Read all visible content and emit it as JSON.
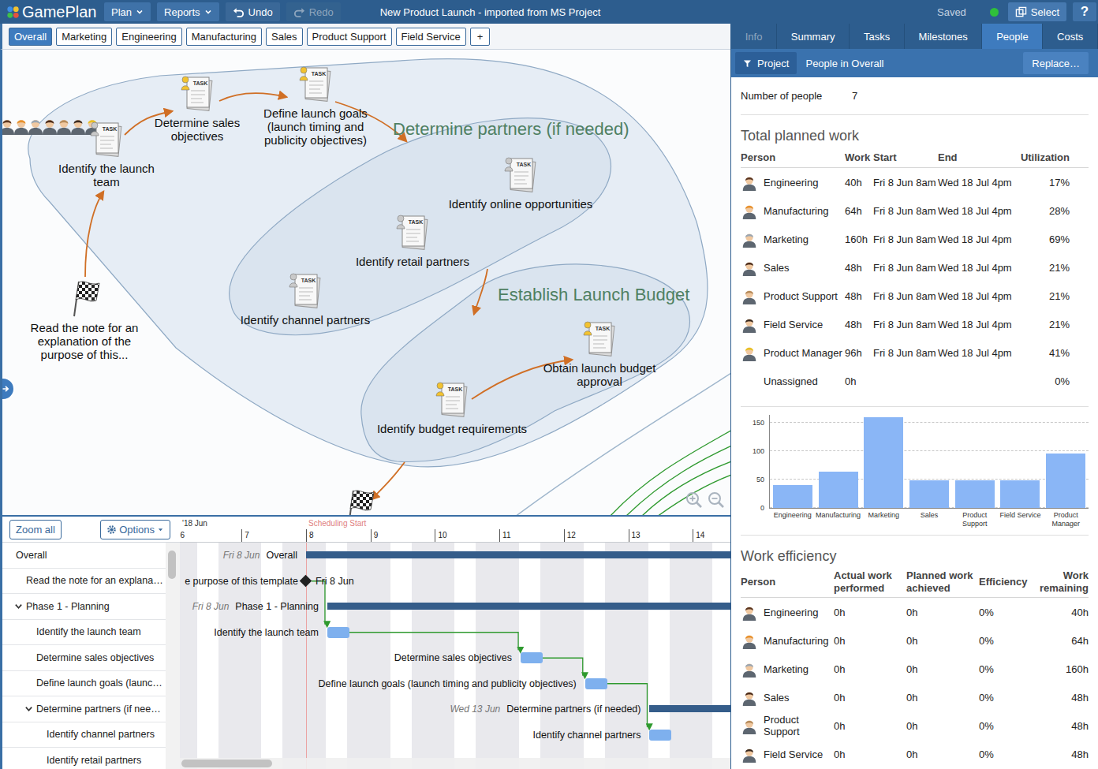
{
  "window": {
    "title": "New Product Launch - imported from MS Project"
  },
  "toolbar": {
    "app_name": "GamePlan",
    "menus": [
      {
        "label": "Plan"
      },
      {
        "label": "Reports"
      }
    ],
    "undo": {
      "label": "Undo",
      "disabled": false
    },
    "redo": {
      "label": "Redo",
      "disabled": true
    },
    "status": "Saved",
    "online": true,
    "select": "Select",
    "help": "?"
  },
  "plan_tabs": [
    {
      "label": "Overall",
      "selected": true
    },
    {
      "label": "Marketing",
      "selected": false
    },
    {
      "label": "Engineering",
      "selected": false
    },
    {
      "label": "Manufacturing",
      "selected": false
    },
    {
      "label": "Sales",
      "selected": false
    },
    {
      "label": "Product Support",
      "selected": false
    },
    {
      "label": "Field Service",
      "selected": false
    }
  ],
  "add_tab": "+",
  "canvas": {
    "task_icon_text": "TASK",
    "groups": [
      {
        "label": "Determine partners (if needed)"
      },
      {
        "label": "Establish Launch Budget"
      }
    ],
    "nodes": [
      {
        "label": "Identify the launch team",
        "kind": "task",
        "manager": false
      },
      {
        "label": "Determine sales objectives",
        "kind": "task",
        "manager": true
      },
      {
        "label": "Define launch goals (launch timing and publicity objectives)",
        "kind": "task",
        "manager": true
      },
      {
        "label": "Identify online opportunities",
        "kind": "task",
        "manager": false
      },
      {
        "label": "Identify retail partners",
        "kind": "task",
        "manager": false
      },
      {
        "label": "Identify channel partners",
        "kind": "task",
        "manager": false
      },
      {
        "label": "Obtain launch budget approval",
        "kind": "task",
        "manager": true
      },
      {
        "label": "Identify budget requirements",
        "kind": "task",
        "manager": true
      },
      {
        "label": "Read the note for an explanation of the purpose of this...",
        "kind": "milestone",
        "manager": false
      }
    ]
  },
  "gantt": {
    "zoom_all": "Zoom all",
    "options": "Options",
    "month": "'18 Jun",
    "scheduling_start": "Scheduling Start",
    "scheduling_start_day": 8,
    "first_day": 6,
    "days": [
      "6",
      "7",
      "8",
      "9",
      "10",
      "11",
      "12",
      "13",
      "14"
    ],
    "rows": [
      {
        "label": "Overall",
        "depth": 0,
        "expandable": false,
        "expanded": false
      },
      {
        "label": "Read the note for an explana…",
        "depth": 1,
        "expandable": false,
        "expanded": false
      },
      {
        "label": "Phase 1 - Planning",
        "depth": 1,
        "expandable": true,
        "expanded": true
      },
      {
        "label": "Identify the launch team",
        "depth": 2,
        "expandable": false,
        "expanded": false
      },
      {
        "label": "Determine sales objectives",
        "depth": 2,
        "expandable": false,
        "expanded": false
      },
      {
        "label": "Define launch goals (launc…",
        "depth": 2,
        "expandable": false,
        "expanded": false
      },
      {
        "label": "Determine partners (if nee…",
        "depth": 2,
        "expandable": true,
        "expanded": true
      },
      {
        "label": "Identify channel partners",
        "depth": 3,
        "expandable": false,
        "expanded": false
      },
      {
        "label": "Identify retail partners",
        "depth": 3,
        "expandable": false,
        "expanded": false
      }
    ],
    "items": [
      {
        "kind": "summary",
        "start": 8,
        "end": 20,
        "label": "Overall",
        "date": "Fri 8 Jun"
      },
      {
        "kind": "milestone",
        "start": 8,
        "end": 8,
        "label": "e purpose of this template",
        "date": "Fri 8 Jun"
      },
      {
        "kind": "summary",
        "start": 8.33,
        "end": 20,
        "label": "Phase 1 - Planning",
        "date": "Fri 8 Jun"
      },
      {
        "kind": "task",
        "start": 8.33,
        "end": 8.67,
        "label": "Identify the launch team",
        "date": ""
      },
      {
        "kind": "task",
        "start": 11.33,
        "end": 11.67,
        "label": "Determine sales objectives",
        "date": ""
      },
      {
        "kind": "task",
        "start": 12.33,
        "end": 12.67,
        "label": "Define launch goals (launch timing and publicity objectives)",
        "date": ""
      },
      {
        "kind": "summary",
        "start": 13.33,
        "end": 20,
        "label": "Determine partners (if needed)",
        "date": "Wed 13 Jun"
      },
      {
        "kind": "task",
        "start": 13.33,
        "end": 13.67,
        "label": "Identify channel partners",
        "date": ""
      }
    ],
    "links": [
      [
        1,
        3
      ],
      [
        3,
        4
      ],
      [
        4,
        5
      ],
      [
        5,
        7
      ]
    ]
  },
  "side": {
    "tabs": [
      {
        "label": "Info",
        "selected": false,
        "disabled": true
      },
      {
        "label": "Summary",
        "selected": false,
        "disabled": false
      },
      {
        "label": "Tasks",
        "selected": false,
        "disabled": false
      },
      {
        "label": "Milestones",
        "selected": false,
        "disabled": false
      },
      {
        "label": "People",
        "selected": true,
        "disabled": false
      },
      {
        "label": "Costs",
        "selected": false,
        "disabled": false
      }
    ],
    "filter": {
      "button": "Project",
      "title": "People in Overall",
      "action": "Replace…"
    },
    "count": {
      "label": "Number of people",
      "value": "7"
    },
    "planned": {
      "title": "Total planned work",
      "columns": [
        "Person",
        "Work",
        "Start",
        "End",
        "Utilization"
      ],
      "rows": [
        {
          "name": "Engineering",
          "work": "40h",
          "start": "Fri 8 Jun 8am",
          "end": "Wed 18 Jul 4pm",
          "utilization": "17%",
          "avatar": true,
          "color": "#5a3520"
        },
        {
          "name": "Manufacturing",
          "work": "64h",
          "start": "Fri 8 Jun 8am",
          "end": "Wed 18 Jul 4pm",
          "utilization": "28%",
          "avatar": true,
          "color": "#e8902a"
        },
        {
          "name": "Marketing",
          "work": "160h",
          "start": "Fri 8 Jun 8am",
          "end": "Wed 18 Jul 4pm",
          "utilization": "69%",
          "avatar": true,
          "color": "#9aa6b2"
        },
        {
          "name": "Sales",
          "work": "48h",
          "start": "Fri 8 Jun 8am",
          "end": "Wed 18 Jul 4pm",
          "utilization": "21%",
          "avatar": true,
          "color": "#4a2a18"
        },
        {
          "name": "Product Support",
          "work": "48h",
          "start": "Fri 8 Jun 8am",
          "end": "Wed 18 Jul 4pm",
          "utilization": "21%",
          "avatar": true,
          "color": "#b58a5a"
        },
        {
          "name": "Field Service",
          "work": "48h",
          "start": "Fri 8 Jun 8am",
          "end": "Wed 18 Jul 4pm",
          "utilization": "21%",
          "avatar": true,
          "color": "#3a2a20"
        },
        {
          "name": "Product Manager",
          "work": "96h",
          "start": "Fri 8 Jun 8am",
          "end": "Wed 18 Jul 4pm",
          "utilization": "41%",
          "avatar": true,
          "color": "#e8c020"
        },
        {
          "name": "Unassigned",
          "work": "0h",
          "start": "",
          "end": "",
          "utilization": "0%",
          "avatar": false,
          "color": ""
        }
      ]
    },
    "chart": {
      "ticks": [
        "150",
        "100",
        "50",
        "0"
      ],
      "labels": [
        "Engineering",
        "Manufacturing",
        "Marketing",
        "Sales",
        "Product Support",
        "Field Service",
        "Product Manager"
      ],
      "values": [
        40,
        64,
        160,
        48,
        48,
        48,
        96
      ]
    },
    "efficiency": {
      "title": "Work efficiency",
      "columns": [
        "Person",
        "Actual work performed",
        "Planned work achieved",
        "Efficiency",
        "Work remaining"
      ],
      "rows": [
        {
          "name": "Engineering",
          "actual": "0h",
          "achieved": "0h",
          "efficiency": "0%",
          "remaining": "40h"
        },
        {
          "name": "Manufacturing",
          "actual": "0h",
          "achieved": "0h",
          "efficiency": "0%",
          "remaining": "64h"
        },
        {
          "name": "Marketing",
          "actual": "0h",
          "achieved": "0h",
          "efficiency": "0%",
          "remaining": "160h"
        },
        {
          "name": "Sales",
          "actual": "0h",
          "achieved": "0h",
          "efficiency": "0%",
          "remaining": "48h"
        },
        {
          "name": "Product Support",
          "actual": "0h",
          "achieved": "0h",
          "efficiency": "0%",
          "remaining": "48h"
        },
        {
          "name": "Field Service",
          "actual": "0h",
          "achieved": "0h",
          "efficiency": "0%",
          "remaining": "48h"
        }
      ]
    }
  }
}
